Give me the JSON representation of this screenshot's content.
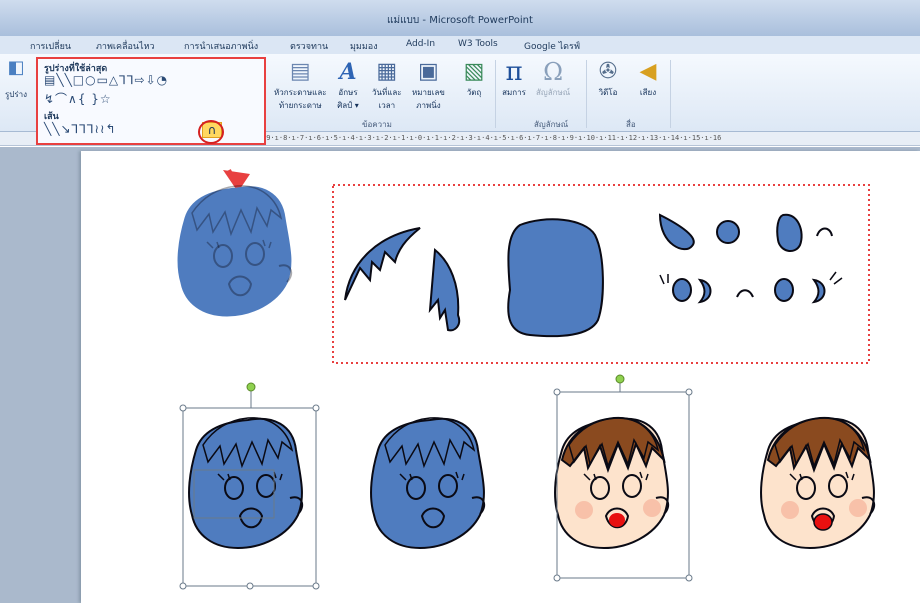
{
  "window": {
    "title": "แม่แบบ - Microsoft PowerPoint"
  },
  "tabs": [
    {
      "label": "การเปลี่ยน"
    },
    {
      "label": "ภาพเคลื่อนไหว"
    },
    {
      "label": "การนำเสนอภาพนิ่ง"
    },
    {
      "label": "ตรวจทาน"
    },
    {
      "label": "มุมมอง"
    },
    {
      "label": "Add-In"
    },
    {
      "label": "W3 Tools"
    },
    {
      "label": "Google ไดรฟ์"
    }
  ],
  "ribbon": {
    "left_button": "รูปร่าง",
    "textbox_buttons": [
      {
        "label": "หัวกระดาษและ",
        "label2": "ท้ายกระดาษ",
        "icon": "header-footer-icon"
      },
      {
        "label": "อักษร",
        "label2": "ศิลป์ ▾",
        "icon": "wordart-icon"
      },
      {
        "label": "วันที่และ",
        "label2": "เวลา",
        "icon": "date-time-icon"
      },
      {
        "label": "หมายเลข",
        "label2": "ภาพนิ่ง",
        "icon": "slide-number-icon"
      },
      {
        "label": "วัตถุ",
        "label2": "",
        "icon": "object-icon"
      }
    ],
    "text_group_label": "ข้อความ",
    "symbols": [
      {
        "label": "สมการ",
        "icon": "pi-icon"
      },
      {
        "label": "สัญลักษณ์",
        "icon": "omega-icon"
      }
    ],
    "symbols_group_label": "สัญลักษณ์",
    "media": [
      {
        "label": "วิดีโอ",
        "icon": "film-icon"
      },
      {
        "label": "เสียง",
        "icon": "speaker-icon"
      }
    ],
    "media_group_label": "สื่อ",
    "partial_label": "าม"
  },
  "shapes_panel": {
    "recent_header": "รูปร่างที่ใช้ล่าสุด",
    "recent_row1": "▤╲╲□○▭△⅂⅂⇨⇩◔",
    "recent_row2": "↯⌒∧{ }☆",
    "lines_header": "เส้น",
    "lines_row": "╲╲↘⅂⅂⅂≀≀↰",
    "selected_shape": "curve-icon"
  },
  "ruler": {
    "text": "·9·ı·8·ı·7·ı·6·ı·5·ı·4·ı·3·ı·2·ı·1·ı·0·ı·1·ı·2·ı·3·ı·4·ı·5·ı·6·ı·7·ı·8·ı·9·ı·10·ı·11·ı·12·ı·13·ı·14·ı·15·ı·16"
  },
  "colors": {
    "face_blue": "#4f7cbf",
    "outline": "#0a0a14",
    "hair_brown": "#8a4a1f",
    "skin": "#fde3cc",
    "cheek": "#f6b8a0",
    "mouth_red": "#e81010",
    "selection_red": "#e84040",
    "handle_green": "#8fd14f"
  }
}
